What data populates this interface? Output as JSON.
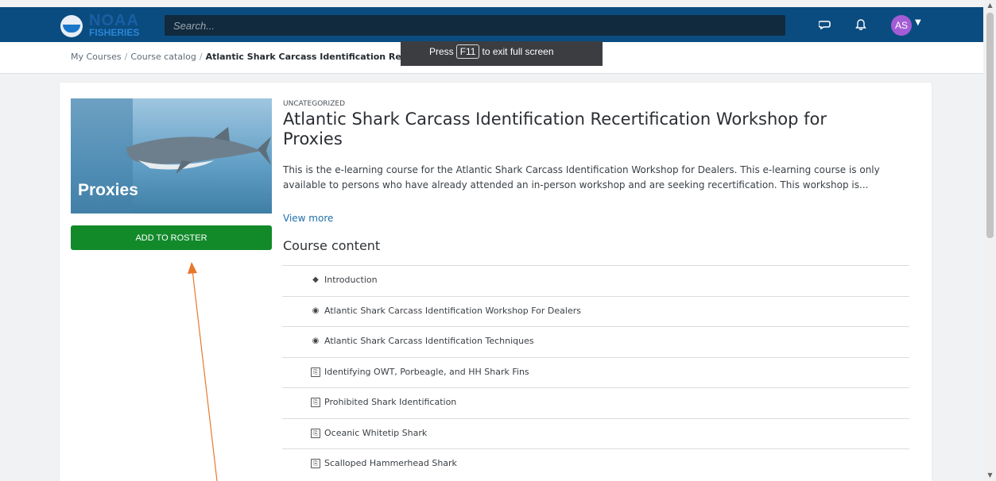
{
  "header": {
    "logo_top": "NOAA",
    "logo_bottom": "FISHERIES",
    "search_placeholder": "Search...",
    "avatar_initials": "AS"
  },
  "breadcrumbs": {
    "items": [
      "My Courses",
      "Course catalog",
      "Atlantic Shark Carcass Identification Recertification Workshop for Proxies"
    ]
  },
  "toast": {
    "prefix": "Press",
    "key": "F11",
    "suffix": "to exit full screen"
  },
  "course": {
    "image_label": "Proxies",
    "add_button": "ADD TO ROSTER",
    "category": "UNCATEGORIZED",
    "title": "Atlantic Shark Carcass Identification Recertification Workshop for Proxies",
    "description": "This is the e-learning course for the Atlantic Shark Carcass Identification Workshop for Dealers. This e-learning course is only available to persons who have already attended an in-person workshop and are seeking recertification. This workshop is...",
    "view_more": "View more",
    "content_heading": "Course content",
    "content_items": [
      {
        "label": "Introduction",
        "icon": "cube-icon"
      },
      {
        "label": "Atlantic Shark Carcass Identification Workshop For Dealers",
        "icon": "play-circle-icon"
      },
      {
        "label": "Atlantic Shark Carcass Identification Techniques",
        "icon": "play-circle-icon"
      },
      {
        "label": "Identifying OWT, Porbeagle, and HH Shark Fins",
        "icon": "pdf-icon"
      },
      {
        "label": "Prohibited Shark Identification",
        "icon": "pdf-icon"
      },
      {
        "label": "Oceanic Whitetip Shark",
        "icon": "pdf-icon"
      },
      {
        "label": "Scalloped Hammerhead Shark",
        "icon": "pdf-icon"
      }
    ]
  },
  "colors": {
    "header_bg": "#0a4c80",
    "add_button_bg": "#128a2a",
    "avatar_bg": "#a45cd6",
    "link": "#1f6faa",
    "annotation_arrow": "#e8772e"
  }
}
